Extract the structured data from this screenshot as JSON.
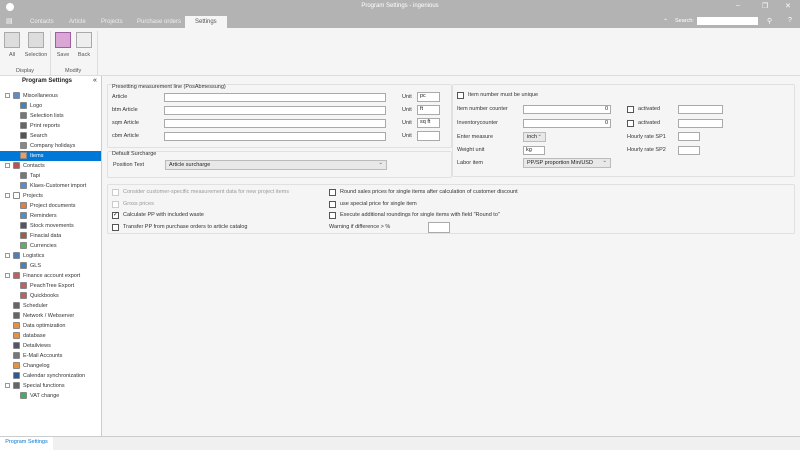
{
  "window": {
    "title": "Program Settings - ingenious",
    "search_label": "Search:",
    "search_value": ""
  },
  "tabs": [
    "Contacts",
    "Article",
    "Projects",
    "Purchase orders",
    "Settings"
  ],
  "active_tab": "Settings",
  "ribbon": {
    "all": "All",
    "selection": "Selection",
    "save": "Save",
    "back": "Back",
    "display_group": "Display",
    "modify_group": "Modify"
  },
  "sidebar": {
    "title": "Program Settings",
    "items": [
      {
        "label": "Miscellaneous",
        "level": 0,
        "exp": true,
        "color": "#5b8bd0"
      },
      {
        "label": "Logo",
        "level": 1,
        "color": "#4a7fc0"
      },
      {
        "label": "Selection lists",
        "level": 1,
        "color": "#777"
      },
      {
        "label": "Print reports",
        "level": 1,
        "color": "#666"
      },
      {
        "label": "Search",
        "level": 1,
        "color": "#555"
      },
      {
        "label": "Company holidays",
        "level": 1,
        "color": "#888"
      },
      {
        "label": "Items",
        "level": 0,
        "selected": true,
        "color": "#e8a060"
      },
      {
        "label": "Contacts",
        "level": 0,
        "exp": true,
        "color": "#c05050"
      },
      {
        "label": "Tapi",
        "level": 1,
        "color": "#777"
      },
      {
        "label": "Klaes-Customer import",
        "level": 1,
        "color": "#5b8bd0"
      },
      {
        "label": "Projects",
        "level": 0,
        "exp": true,
        "color": "#fff"
      },
      {
        "label": "Project documents",
        "level": 1,
        "color": "#e08040"
      },
      {
        "label": "Reminders",
        "level": 1,
        "color": "#4a90d0"
      },
      {
        "label": "Stock movements",
        "level": 1,
        "color": "#556"
      },
      {
        "label": "Finacial data",
        "level": 1,
        "color": "#a06040"
      },
      {
        "label": "Currencies",
        "level": 1,
        "color": "#60b060"
      },
      {
        "label": "Logistics",
        "level": 0,
        "exp": true,
        "color": "#4a7fc0"
      },
      {
        "label": "GLS",
        "level": 1,
        "color": "#4a7fc0"
      },
      {
        "label": "Finance account export",
        "level": 0,
        "exp": true,
        "color": "#c06060"
      },
      {
        "label": "PeachTree Export",
        "level": 1,
        "color": "#c06060"
      },
      {
        "label": "Quickbooks",
        "level": 1,
        "color": "#c06060"
      },
      {
        "label": "Scheduler",
        "level": 0,
        "color": "#666"
      },
      {
        "label": "Network / Webserver",
        "level": 0,
        "color": "#666"
      },
      {
        "label": "Data optimization",
        "level": 0,
        "color": "#e89040"
      },
      {
        "label": "database",
        "level": 0,
        "color": "#e89040"
      },
      {
        "label": "Detailviews",
        "level": 0,
        "color": "#556"
      },
      {
        "label": "E-Mail Accounts",
        "level": 0,
        "color": "#777"
      },
      {
        "label": "Changelog",
        "level": 0,
        "color": "#e89040"
      },
      {
        "label": "Calendar synchronization",
        "level": 0,
        "color": "#2a5a9a"
      },
      {
        "label": "Special functions",
        "level": 0,
        "exp": true,
        "color": "#666"
      },
      {
        "label": "VAT change",
        "level": 1,
        "color": "#40b060"
      }
    ]
  },
  "measure": {
    "title": "Presetting measurement line (PosAbmessung)",
    "unit_label": "Unit",
    "rows": [
      {
        "label": "Article",
        "value": "",
        "unit": "pc"
      },
      {
        "label": "btm Article",
        "value": "",
        "unit": "ft"
      },
      {
        "label": "sqm Article",
        "value": "",
        "unit": "sq ft"
      },
      {
        "label": "cbm Article",
        "value": "",
        "unit": ""
      }
    ]
  },
  "surcharge": {
    "title": "Default Surcharge",
    "position_label": "Position Text",
    "position_value": "Article surcharge"
  },
  "right": {
    "unique_label": "Item number must be unique",
    "item_counter_label": "Item number counter",
    "item_counter_value": "0",
    "inventory_label": "Inventorycounter",
    "inventory_value": "0",
    "activated1": "activated",
    "activated2": "activated",
    "enter_measure_label": "Enter measure",
    "enter_measure_value": "inch",
    "weight_label": "Weight unit",
    "weight_value": "kg",
    "labor_label": "Labor item",
    "labor_value": "PP/SP proportion Min/USD",
    "rate1_label": "Hourly rate SP1",
    "rate2_label": "Hourly rate SP2"
  },
  "options": {
    "consider": "Consider customer-specific measurement data for new project items",
    "gross": "Gross prices",
    "calc_pp": "Calculate PP with included waste",
    "transfer_pp": "Transfer PP from purchase orders to article catalog",
    "round_sales": "Round sales prices for single items after calculation of customer discount",
    "special_price": "use special price for single item",
    "execute_round": "Execute additional roundings for single items with field \"Round to\"",
    "warning": "Warning if difference > %"
  },
  "statusbar": {
    "tab": "Program Settings"
  },
  "colors": {
    "accent": "#0078d7",
    "titlebar": "#b3b3b3"
  }
}
